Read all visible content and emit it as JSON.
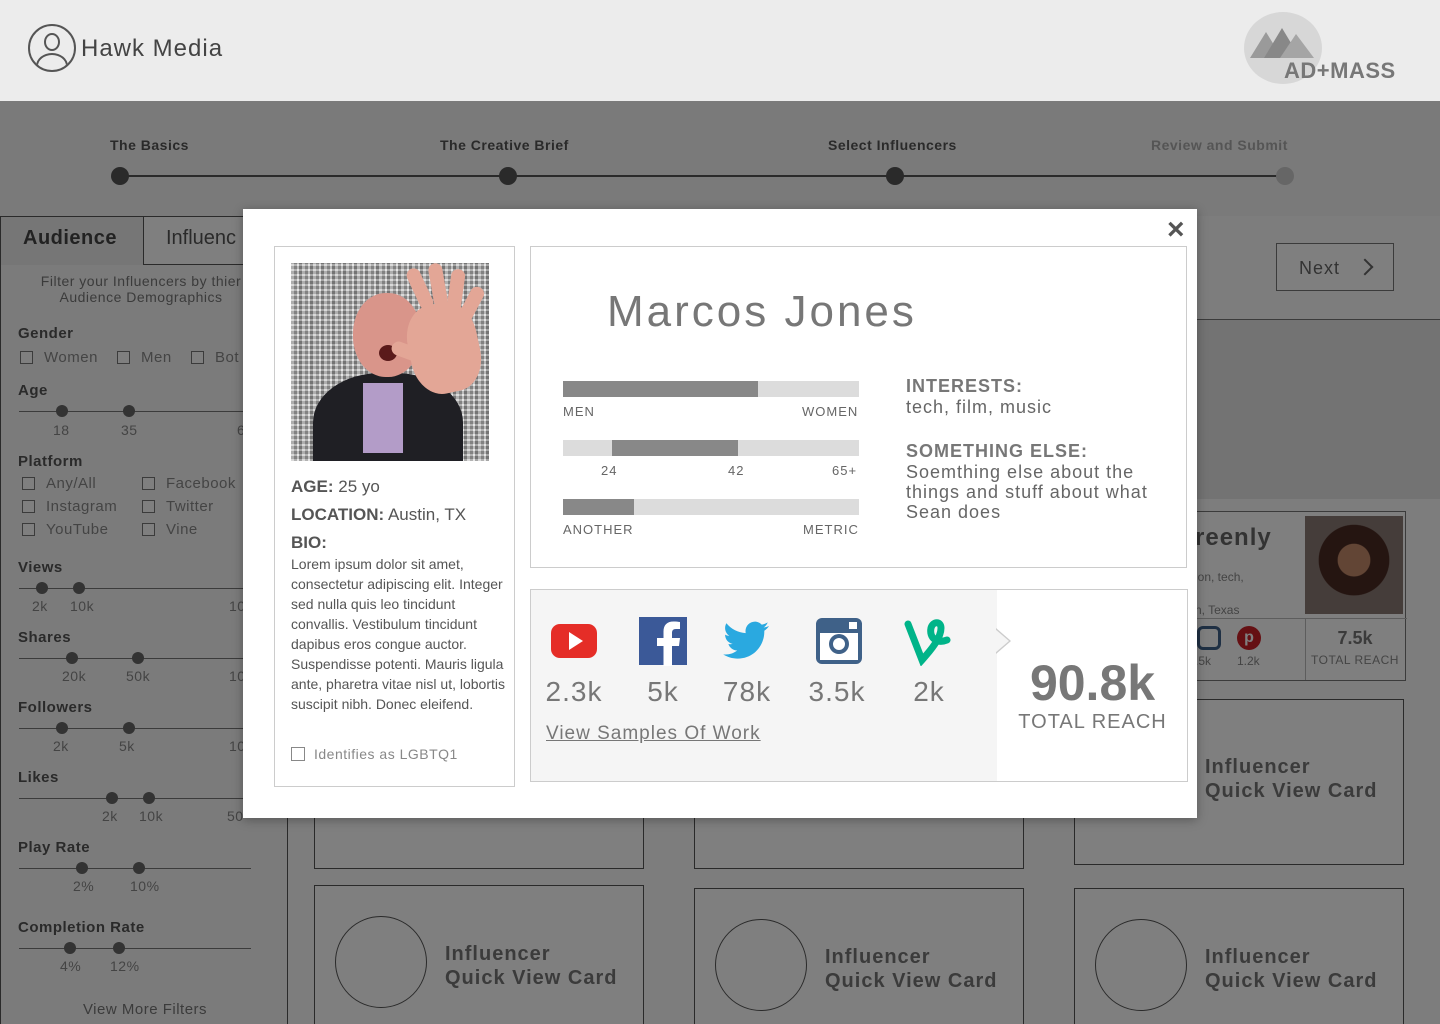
{
  "header": {
    "brand": "Hawk Media",
    "partner_logo": "AD+MASS"
  },
  "steps": [
    {
      "label": "The Basics",
      "state": "done"
    },
    {
      "label": "The Creative Brief",
      "state": "done"
    },
    {
      "label": "Select Influencers",
      "state": "current"
    },
    {
      "label": "Review and Submit",
      "state": "upcoming"
    }
  ],
  "sidebar": {
    "tabs": [
      "Audience",
      "Influenc"
    ],
    "hint": "Filter your Influencers by thier Audience Demographics",
    "gender": {
      "title": "Gender",
      "options": [
        "Women",
        "Men",
        "Bot"
      ]
    },
    "age": {
      "title": "Age",
      "values": [
        "18",
        "35",
        "6"
      ]
    },
    "platform": {
      "title": "Platform",
      "options": [
        "Any/All",
        "Facebook",
        "Instagram",
        "Twitter",
        "YouTube",
        "Vine"
      ]
    },
    "views": {
      "title": "Views",
      "values": [
        "2k",
        "10k",
        "10"
      ]
    },
    "shares": {
      "title": "Shares",
      "values": [
        "20k",
        "50k",
        "10"
      ]
    },
    "followers": {
      "title": "Followers",
      "values": [
        "2k",
        "5k",
        "10"
      ]
    },
    "likes": {
      "title": "Likes",
      "values": [
        "2k",
        "10k",
        "50"
      ]
    },
    "play_rate": {
      "title": "Play Rate",
      "values": [
        "2%",
        "10%"
      ]
    },
    "completion_rate": {
      "title": "Completion Rate",
      "values": [
        "4%",
        "12%"
      ]
    },
    "view_more": "View More Filters"
  },
  "next_button": "Next",
  "quick_card": {
    "line1": "Influencer",
    "line2": "Quick View Card"
  },
  "peek_card": {
    "name": "reenly",
    "sub1": "ion, tech,",
    "sub2": "n, Texas",
    "counts": [
      ".5k",
      "1.2k"
    ],
    "reach": "7.5k",
    "reach_label": "TOTAL REACH"
  },
  "modal": {
    "close": "×",
    "name": "Marcos Jones",
    "age_label": "AGE:",
    "age": "25 yo",
    "location_label": "LOCATION:",
    "location": "Austin, TX",
    "bio_label": "BIO:",
    "bio": "Lorem ipsum dolor sit amet, consectetur adipiscing elit. Integer sed nulla quis leo tincidunt convallis. Vestibulum tincidunt dapibus eros congue auctor. Suspendisse potenti. Mauris ligula ante, pharetra vitae nisl ut, lobortis suscipit nibh. Donec eleifend.",
    "lgbtq_label": "Identifies as LGBTQ1",
    "bars": [
      {
        "left": "MEN",
        "right": "WOMEN",
        "from": 0,
        "to": 0.66
      },
      {
        "tick1": "24",
        "tick2": "42",
        "tick3": "65+",
        "from": 0.165,
        "to": 0.59
      },
      {
        "left": "ANOTHER",
        "right": "METRIC",
        "from": 0,
        "to": 0.24
      }
    ],
    "interests_label": "INTERESTS:",
    "interests": "tech, film, music",
    "else_label": "SOMETHING ELSE:",
    "else_text": "Soemthing else about the things and stuff about what Sean does",
    "socials": [
      {
        "icon": "youtube-icon",
        "count": "2.3k",
        "color": "#e52d27"
      },
      {
        "icon": "facebook-icon",
        "count": "5k",
        "color": "#3b5998"
      },
      {
        "icon": "twitter-icon",
        "count": "78k",
        "color": "#2aa9e0"
      },
      {
        "icon": "instagram-icon",
        "count": "3.5k",
        "color": "#3f6188"
      },
      {
        "icon": "vine-icon",
        "count": "2k",
        "color": "#00b489"
      }
    ],
    "samples_link": "View Samples Of Work",
    "total_reach": "90.8k",
    "total_reach_label": "TOTAL REACH"
  }
}
